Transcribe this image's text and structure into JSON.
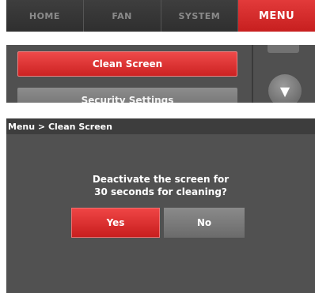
{
  "tabs": [
    {
      "label": "HOME",
      "active": false
    },
    {
      "label": "FAN",
      "active": false
    },
    {
      "label": "SYSTEM",
      "active": false
    },
    {
      "label": "MENU",
      "active": true
    }
  ],
  "menu": {
    "items": [
      {
        "label": "Clean Screen",
        "selected": true
      },
      {
        "label": "Security Settings",
        "selected": false
      }
    ],
    "scroll_down_glyph": "▼"
  },
  "dialog": {
    "breadcrumb": "Menu > Clean Screen",
    "prompt_line1": "Deactivate the screen for",
    "prompt_line2": "30 seconds for cleaning?",
    "yes_label": "Yes",
    "no_label": "No"
  },
  "colors": {
    "accent_red": "#d42a2a",
    "panel_gray": "#515151",
    "tab_dark": "#353535",
    "button_gray": "#7a7a7a"
  }
}
